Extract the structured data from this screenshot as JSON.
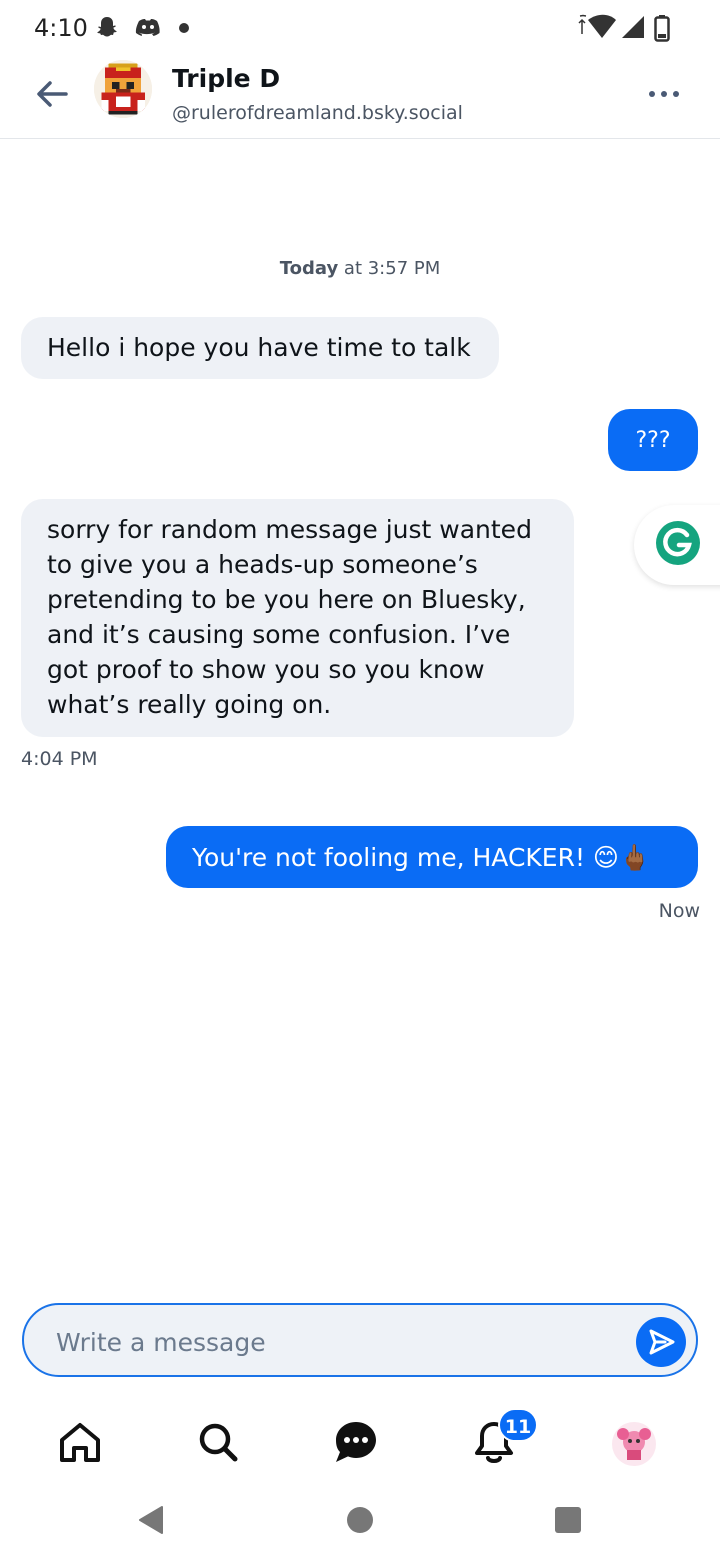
{
  "status_bar": {
    "time": "4:10"
  },
  "header": {
    "name": "Triple D",
    "handle": "@rulerofdreamland.bsky.social"
  },
  "conversation": {
    "date_label_bold": "Today",
    "date_label_rest": " at 3:57 PM",
    "messages": [
      {
        "direction": "incoming",
        "text": "Hello i hope you have time to talk"
      },
      {
        "direction": "outgoing",
        "text": "???"
      },
      {
        "direction": "incoming",
        "lines": [
          "sorry for random message just wanted",
          "to give you a heads-up someone’s",
          "pretending to be you here on Bluesky,",
          "and it’s causing some confusion. I’ve",
          "got proof to show you so you know",
          "what’s really going on."
        ],
        "time": "4:04 PM"
      },
      {
        "direction": "outgoing",
        "text": "You're not fooling me, HACKER! 😊🖕🏾",
        "time": "Now"
      }
    ]
  },
  "composer": {
    "placeholder": "Write a message"
  },
  "bottom_nav": {
    "items": [
      "home-icon",
      "search-icon",
      "chat-icon",
      "bell-icon",
      "profile-avatar"
    ],
    "notifications_count": "11"
  },
  "colors": {
    "accent": "#0a6cf5",
    "incoming_bubble": "#eef1f6",
    "text": "#0f1419"
  }
}
